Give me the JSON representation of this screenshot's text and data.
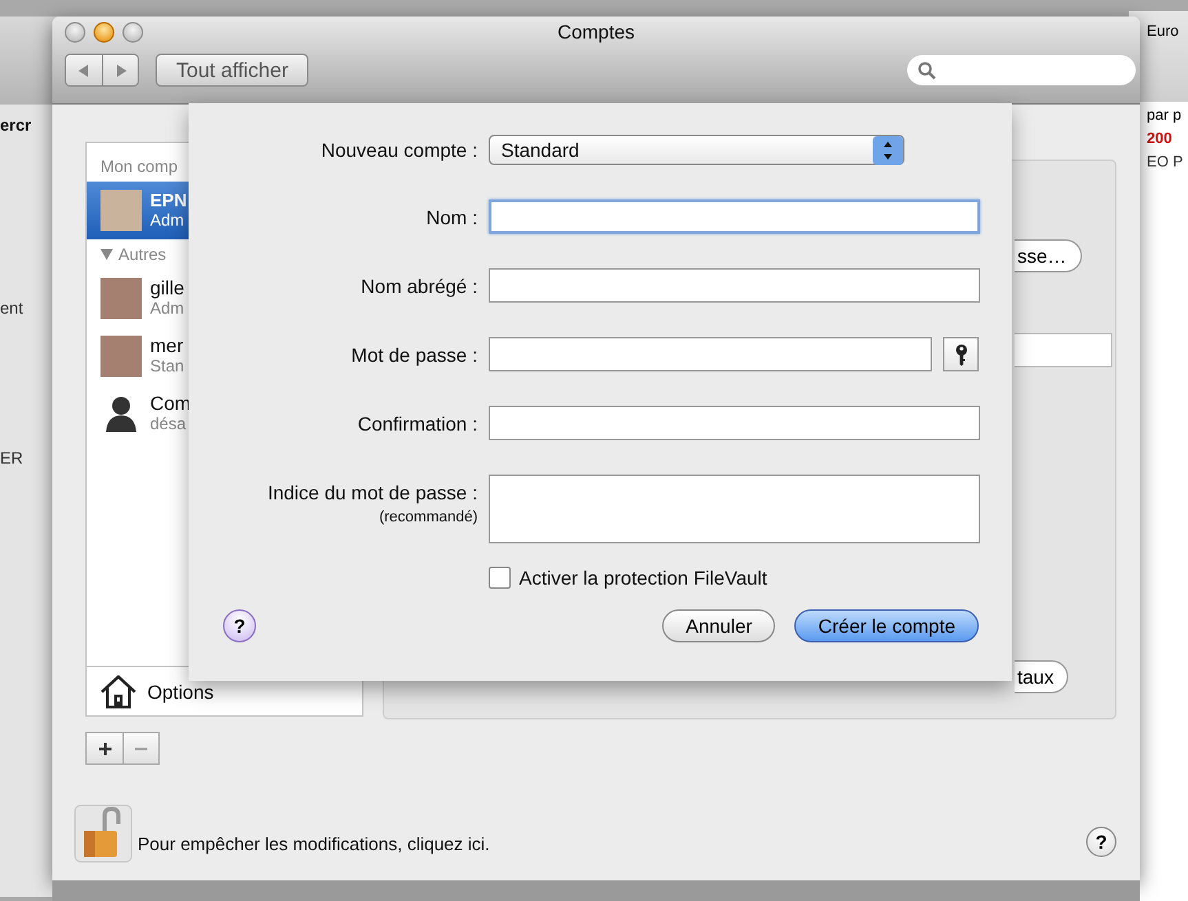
{
  "background_left_window": {
    "texts": [
      "ercr",
      "ent",
      "ER"
    ]
  },
  "background_right_window": {
    "lines": [
      {
        "text": "Euro",
        "color": "#000000"
      },
      {
        "text": "par p",
        "color": "#000000"
      },
      {
        "text": "200",
        "color": "#cc1111"
      },
      {
        "text": "EO P",
        "color": "#333333"
      }
    ]
  },
  "window": {
    "title": "Comptes",
    "show_all_button": "Tout afficher"
  },
  "sidebar": {
    "sections": [
      {
        "heading": "Mon comp",
        "items": [
          {
            "name": "EPN",
            "role": "Adm",
            "selected": true,
            "kind": "photo"
          }
        ]
      },
      {
        "heading": "Autres",
        "expanded": true,
        "items": [
          {
            "name": "gille",
            "role": "Adm",
            "selected": false,
            "kind": "photo"
          },
          {
            "name": "mer",
            "role": "Stan",
            "selected": false,
            "kind": "photo"
          },
          {
            "name": "Com",
            "role": "désa",
            "selected": false,
            "kind": "silhouette"
          }
        ]
      }
    ],
    "options": "Options"
  },
  "panel_behind": {
    "buttons": [
      "sse…",
      "taux"
    ]
  },
  "sheet": {
    "account_type_label": "Nouveau compte :",
    "account_type": "Standard",
    "fields": [
      {
        "label": "Nom :",
        "kind": "text",
        "focused": true
      },
      {
        "label": "Nom abrégé :",
        "kind": "text",
        "focused": false
      },
      {
        "label": "Mot de passe :",
        "kind": "password",
        "focused": false
      },
      {
        "label": "Confirmation :",
        "kind": "text",
        "focused": false
      },
      {
        "label": "Indice du mot de passe :",
        "note": "(recommandé)",
        "kind": "multiline",
        "focused": false
      }
    ],
    "filevault": {
      "label": "Activer la protection FileVault",
      "checked": false
    },
    "help_button": "?",
    "buttons": [
      {
        "label": "Annuler",
        "default": false
      },
      {
        "label": "Créer le compte",
        "default": true
      }
    ]
  },
  "footer": {
    "lock_text": "Pour empêcher les modifications, cliquez ici.",
    "help_button": "?"
  }
}
